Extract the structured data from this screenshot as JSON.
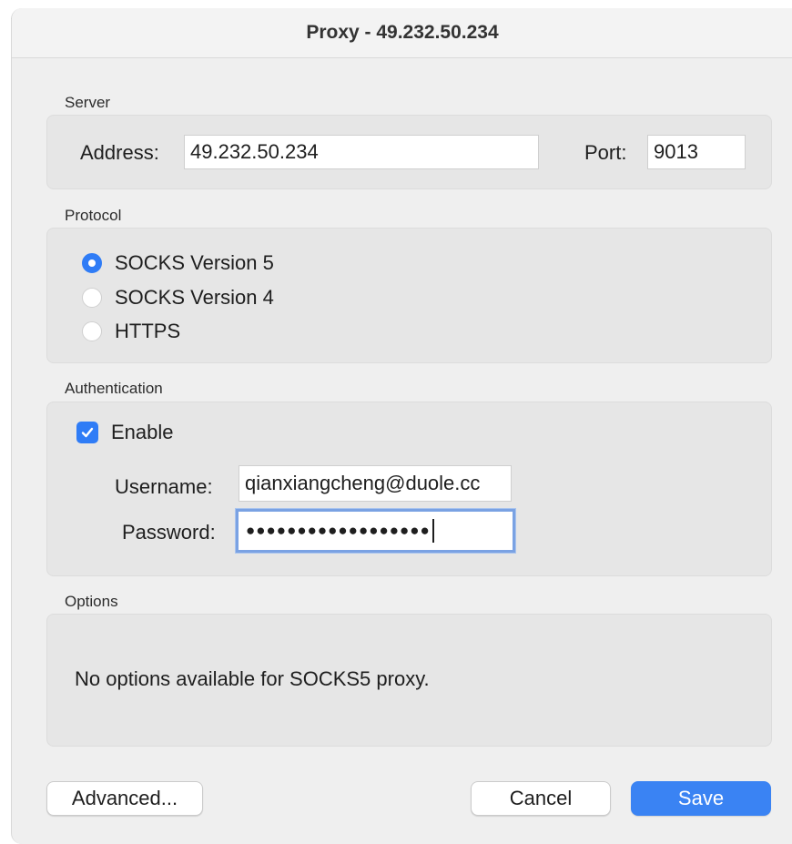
{
  "window": {
    "title": "Proxy - 49.232.50.234"
  },
  "server": {
    "section_label": "Server",
    "address_label": "Address:",
    "address_value": "49.232.50.234",
    "port_label": "Port:",
    "port_value": "9013"
  },
  "protocol": {
    "section_label": "Protocol",
    "options": [
      {
        "label": "SOCKS Version 5",
        "selected": true
      },
      {
        "label": "SOCKS Version 4",
        "selected": false
      },
      {
        "label": "HTTPS",
        "selected": false
      }
    ]
  },
  "authentication": {
    "section_label": "Authentication",
    "enable_label": "Enable",
    "enabled": true,
    "username_label": "Username:",
    "username_value": "qianxiangcheng@duole.cc",
    "password_label": "Password:",
    "password_mask": "●●●●●●●●●●●●●●●●●●"
  },
  "options": {
    "section_label": "Options",
    "message": "No options available for SOCKS5 proxy."
  },
  "buttons": {
    "advanced": "Advanced...",
    "cancel": "Cancel",
    "save": "Save"
  },
  "colors": {
    "accent": "#3a83f3",
    "focus_ring": "#7aa2e3",
    "group_bg": "#e6e6e6"
  },
  "icons": {
    "checkbox": "checkmark-icon"
  }
}
